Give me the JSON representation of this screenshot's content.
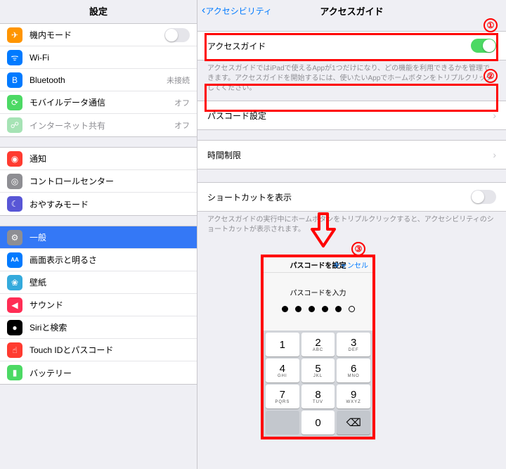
{
  "sidebar": {
    "title": "設定",
    "g1": [
      {
        "icon": "✈︎",
        "bg": "#ff9500",
        "label": "機内モード",
        "type": "switch",
        "on": false
      },
      {
        "icon": "ᯤ",
        "bg": "#007aff",
        "label": "Wi-Fi",
        "val": ""
      },
      {
        "icon": "B",
        "bg": "#007aff",
        "label": "Bluetooth",
        "val": "未接続"
      },
      {
        "icon": "⟳",
        "bg": "#4cd964",
        "label": "モバイルデータ通信",
        "val": "オフ"
      },
      {
        "icon": "☍",
        "bg": "#a6e3b5",
        "label": "インターネット共有",
        "val": "オフ",
        "dim": true
      }
    ],
    "g2": [
      {
        "icon": "◉",
        "bg": "#ff3b30",
        "label": "通知"
      },
      {
        "icon": "◎",
        "bg": "#8e8e93",
        "label": "コントロールセンター"
      },
      {
        "icon": "☾",
        "bg": "#5856d6",
        "label": "おやすみモード"
      }
    ],
    "g3": [
      {
        "icon": "⚙",
        "bg": "#8e8e93",
        "label": "一般",
        "sel": true
      },
      {
        "icon": "AA",
        "bg": "#007aff",
        "label": "画面表示と明るさ"
      },
      {
        "icon": "❀",
        "bg": "#34aadc",
        "label": "壁紙"
      },
      {
        "icon": "◀︎",
        "bg": "#ff2d55",
        "label": "サウンド"
      },
      {
        "icon": "●",
        "bg": "#000",
        "label": "Siriと検索"
      },
      {
        "icon": "☝︎",
        "bg": "#ff3b30",
        "label": "Touch IDとパスコード"
      },
      {
        "icon": "▮",
        "bg": "#4cd964",
        "label": "バッテリー"
      }
    ]
  },
  "main": {
    "back": "アクセシビリティ",
    "title": "アクセスガイド",
    "r1": {
      "label": "アクセスガイド",
      "on": true
    },
    "d1": "アクセスガイドではiPadで使えるAppが1つだけになり、どの機能を利用できるかを管理できます。アクセスガイドを開始するには、使いたいAppでホームボタンをトリプルクリックしてください。",
    "r2": {
      "label": "パスコード設定"
    },
    "r3": {
      "label": "時間制限"
    },
    "r4": {
      "label": "ショートカットを表示",
      "on": false
    },
    "d2": "アクセスガイドの実行中にホームボタンをトリプルクリックすると、アクセシビリティのショートカットが表示されます。"
  },
  "annot": {
    "n1": "①",
    "n2": "②",
    "n3": "③"
  },
  "modal": {
    "title": "パスコードを設定",
    "cancel": "キャンセル",
    "prompt": "パスコードを入力",
    "keys": [
      [
        {
          "n": "1",
          "s": ""
        },
        {
          "n": "2",
          "s": "ABC"
        },
        {
          "n": "3",
          "s": "DEF"
        }
      ],
      [
        {
          "n": "4",
          "s": "GHI"
        },
        {
          "n": "5",
          "s": "JKL"
        },
        {
          "n": "6",
          "s": "MNO"
        }
      ],
      [
        {
          "n": "7",
          "s": "PQRS"
        },
        {
          "n": "8",
          "s": "TUV"
        },
        {
          "n": "9",
          "s": "WXYZ"
        }
      ],
      [
        {
          "n": "",
          "blank": true
        },
        {
          "n": "0",
          "s": ""
        },
        {
          "n": "⌫",
          "del": true
        }
      ]
    ]
  }
}
